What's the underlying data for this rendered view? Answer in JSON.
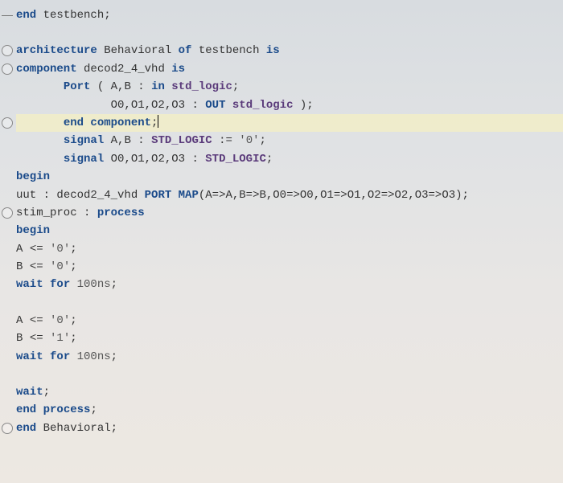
{
  "code": {
    "line1": {
      "k1": "end",
      "ident": " testbench",
      "punct": ";"
    },
    "line2": {
      "k1": "architecture",
      "ident1": " Behavioral ",
      "k2": "of",
      "ident2": " testbench ",
      "k3": "is"
    },
    "line3": {
      "k1": "component",
      "ident": " decod2_4_vhd ",
      "k2": "is"
    },
    "line4": {
      "indent": "       ",
      "k1": "Port",
      "punct1": " ( ",
      "ident1": "A,B ",
      "punct2": ": ",
      "k2": "in",
      "type": " std_logic",
      "punct3": ";"
    },
    "line5": {
      "indent": "              ",
      "ident": "O0,O1,O2,O3 ",
      "punct1": ": ",
      "k1": "OUT",
      "type": " std_logic ",
      "punct2": ");"
    },
    "line6": {
      "indent": "       ",
      "k1": "end",
      "k2": " component",
      "punct": ";"
    },
    "line7": {
      "indent": "       ",
      "k1": "signal",
      "ident": " A,B ",
      "punct1": ": ",
      "type": "STD_LOGIC",
      "punct2": " := ",
      "lit": "'0'",
      "punct3": ";"
    },
    "line8": {
      "indent": "       ",
      "k1": "signal",
      "ident": " O0,O1,O2,O3 ",
      "punct1": ": ",
      "type": "STD_LOGIC",
      "punct2": ";"
    },
    "line9": {
      "k1": "begin"
    },
    "line10": {
      "ident1": "uut ",
      "punct1": ": ",
      "ident2": "decod2_4_vhd ",
      "k1": "PORT MAP",
      "punct2": "(",
      "map": "A=>A,B=>B,O0=>O0,O1=>O1,O2=>O2,O3=>O3",
      "punct3": ");"
    },
    "line11": {
      "ident": "stim_proc ",
      "punct": ": ",
      "k1": "process"
    },
    "line12": {
      "k1": "begin"
    },
    "line13": {
      "ident": "A ",
      "punct1": "<= ",
      "lit": "'0'",
      "punct2": ";"
    },
    "line14": {
      "ident": "B ",
      "punct1": "<= ",
      "lit": "'0'",
      "punct2": ";"
    },
    "line15": {
      "k1": "wait",
      "k2": " for ",
      "lit": "100ns",
      "punct": ";"
    },
    "line16": {
      "ident": "A ",
      "punct1": "<= ",
      "lit": "'0'",
      "punct2": ";"
    },
    "line17": {
      "ident": "B ",
      "punct1": "<= ",
      "lit": "'1'",
      "punct2": ";"
    },
    "line18": {
      "k1": "wait",
      "k2": " for ",
      "lit": "100ns",
      "punct": ";"
    },
    "line19": {
      "k1": "wait",
      "punct": ";"
    },
    "line20": {
      "k1": "end",
      "k2": " process",
      "punct": ";"
    },
    "line21": {
      "k1": "end",
      "ident": " Behavioral",
      "punct": ";"
    }
  }
}
